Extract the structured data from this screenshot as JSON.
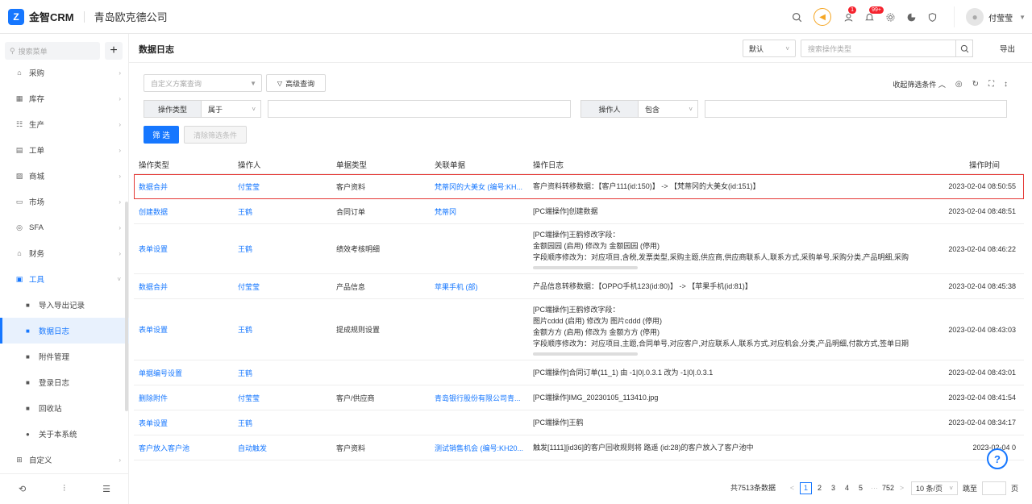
{
  "app": {
    "logo_text": "金智CRM",
    "logo_icon": "crm-logo-icon",
    "company": "青岛欧克德公司"
  },
  "topbar": {
    "badge_msgs": "1",
    "badge_notices": "99+",
    "notice_icon": "speaker-icon",
    "username": "付莹莹"
  },
  "sidebar": {
    "search_placeholder": "搜索菜单",
    "items": [
      {
        "label": "采购",
        "icon": "cart-icon",
        "glyph": "⌂"
      },
      {
        "label": "库存",
        "icon": "warehouse-icon",
        "glyph": "▦"
      },
      {
        "label": "生产",
        "icon": "production-icon",
        "glyph": "☷"
      },
      {
        "label": "工单",
        "icon": "ticket-icon",
        "glyph": "▤"
      },
      {
        "label": "商城",
        "icon": "mall-icon",
        "glyph": "▨"
      },
      {
        "label": "市场",
        "icon": "market-icon",
        "glyph": "▭"
      },
      {
        "label": "SFA",
        "icon": "sfa-icon",
        "glyph": "◎"
      },
      {
        "label": "财务",
        "icon": "finance-icon",
        "glyph": "⌂"
      },
      {
        "label": "工具",
        "icon": "tools-icon",
        "glyph": "▣"
      }
    ],
    "sub_items": [
      {
        "label": "导入导出记录",
        "icon": "import-export-icon",
        "glyph": "■"
      },
      {
        "label": "数据日志",
        "icon": "data-log-icon",
        "glyph": "■"
      },
      {
        "label": "附件管理",
        "icon": "attachment-icon",
        "glyph": "■"
      },
      {
        "label": "登录日志",
        "icon": "login-log-icon",
        "glyph": "■"
      },
      {
        "label": "回收站",
        "icon": "recycle-icon",
        "glyph": "■"
      },
      {
        "label": "关于本系统",
        "icon": "info-icon",
        "glyph": "●"
      }
    ],
    "last_item": {
      "label": "自定义",
      "icon": "custom-icon",
      "glyph": "⊞"
    },
    "bottom_icons": [
      "history-icon",
      "settings-sliders-icon",
      "collapse-menu-icon"
    ]
  },
  "page": {
    "title": "数据日志",
    "sort_select": "默认",
    "search_placeholder": "搜索操作类型",
    "export_label": "导出"
  },
  "filters": {
    "scheme_placeholder": "自定义方案查询",
    "advanced_label": "高级查询",
    "collapse_label": "收起筛选条件",
    "cond1_label": "操作类型",
    "cond1_op": "属于",
    "cond2_label": "操作人",
    "cond2_op": "包含",
    "filter_button": "筛 选",
    "clear_button": "清除筛选条件"
  },
  "table": {
    "headers": [
      "操作类型",
      "操作人",
      "单据类型",
      "关联单据",
      "操作日志",
      "操作时间"
    ],
    "rows": [
      {
        "type": "数据合并",
        "user": "付莹莹",
        "doc_type": "客户资料",
        "related": "梵蒂冈的大美女 (编号:KH...",
        "log": [
          "客户资料转移数据：【客户111(id:150)】 -> 【梵蒂冈的大美女(id:151)】"
        ],
        "time": "2023-02-04 08:50:55",
        "highlight": true
      },
      {
        "type": "创建数据",
        "user": "王鹤",
        "doc_type": "合同订单",
        "related": "梵蒂冈",
        "log": [
          "[PC端操作]创建数据"
        ],
        "time": "2023-02-04 08:48:51"
      },
      {
        "type": "表单设置",
        "user": "王鹤",
        "doc_type": "绩效考核明细",
        "related": "",
        "log": [
          "[PC端操作]王鹤修改字段：",
          "金额园园 (启用) 修改为 金额园园 (停用)",
          "字段顺序修改为：对应项目,含税,发票类型,采购主题,供应商,供应商联系人,联系方式,采购单号,采购分类,产品明细,采购"
        ],
        "time": "2023-02-04 08:46:22",
        "scroll": true
      },
      {
        "type": "数据合并",
        "user": "付莹莹",
        "doc_type": "产品信息",
        "related": "苹果手机 (部)",
        "log": [
          "产品信息转移数据：【OPPO手机123(id:80)】 -> 【苹果手机(id:81)】"
        ],
        "time": "2023-02-04 08:45:38"
      },
      {
        "type": "表单设置",
        "user": "王鹤",
        "doc_type": "提成规则设置",
        "related": "",
        "log": [
          "[PC端操作]王鹤修改字段：",
          "图片cddd (启用) 修改为 图片cddd (停用)",
          "金额方方 (启用) 修改为 金额方方 (停用)",
          "字段顺序修改为：对应项目,主题,合同单号,对应客户,对应联系人,联系方式,对应机会,分类,产品明细,付款方式,签单日期"
        ],
        "time": "2023-02-04 08:43:03",
        "scroll": true
      },
      {
        "type": "单据编号设置",
        "user": "王鹤",
        "doc_type": "",
        "related": "",
        "log": [
          "[PC端操作]合同订单(11_1) 由 -1|0|.0.3.1 改为 -1|0|.0.3.1"
        ],
        "time": "2023-02-04 08:43:01"
      },
      {
        "type": "删除附件",
        "user": "付莹莹",
        "doc_type": "客户/供应商",
        "related": "青岛银行股份有限公司青...",
        "log": [
          "[PC端操作]IMG_20230105_113410.jpg"
        ],
        "time": "2023-02-04 08:41:54"
      },
      {
        "type": "表单设置",
        "user": "王鹤",
        "doc_type": "",
        "related": "",
        "log": [
          "[PC端操作]王鹤"
        ],
        "time": "2023-02-04 08:34:17"
      },
      {
        "type": "客户放入客户池",
        "user": "自动触发",
        "doc_type": "客户资料",
        "related": "测试销售机会 (编号:KH20...",
        "log": [
          "触发[1111][id36]的客户回收规则将 路遥 (id:28)的客户放入了客户池中"
        ],
        "time": "2023-02-04 0"
      }
    ]
  },
  "pagination": {
    "total": "共7513条数据",
    "pages": [
      "<",
      "1",
      "2",
      "3",
      "4",
      "5",
      "···",
      "752",
      ">"
    ],
    "current": "1",
    "page_size": "10 条/页",
    "jump_label": "跳至",
    "page_label": "页"
  },
  "help_label": "?"
}
